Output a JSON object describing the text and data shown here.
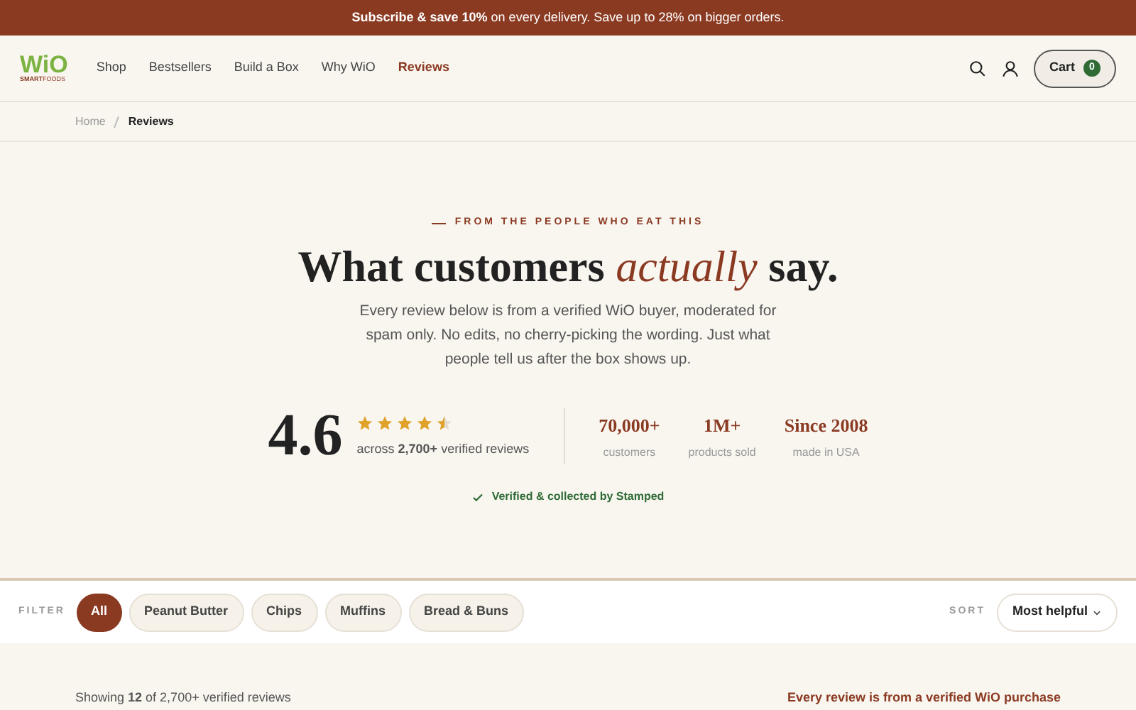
{
  "promo_banner": {
    "text": "**Subscribe & save 10%** on every delivery. Save up to 28% on bigger orders."
  },
  "header": {
    "logo": {
      "wordmark": "WiO",
      "tagline_bold": "SMART",
      "tagline": "FOODS"
    },
    "nav": [
      {
        "label": "Shop",
        "selected": false
      },
      {
        "label": "Bestsellers",
        "selected": false
      },
      {
        "label": "Build a Box",
        "selected": false
      },
      {
        "label": "Why WiO",
        "selected": false
      },
      {
        "label": "Reviews",
        "selected": true
      }
    ],
    "cart": {
      "label": "Cart",
      "count": "0"
    }
  },
  "breadcrumb": [
    {
      "label": "Home",
      "current": false
    },
    {
      "label": "Reviews",
      "current": true
    }
  ],
  "hero": {
    "eyebrow": "FROM THE PEOPLE WHO EAT THIS",
    "title_start": "What customers",
    "title_emphasis": "actually",
    "title_end": "say.",
    "intro": "Every review below is from a verified WiO buyer, moderated for spam only. No edits, no cherry-picking the wording. Just what people tell us after the box shows up.",
    "rating": {
      "score": "4.6",
      "stars": 4.5,
      "summary": "across **2,700+** verified reviews"
    },
    "stats": [
      {
        "value": "70,000+",
        "label": "customers"
      },
      {
        "value": "1M+",
        "label": "products sold"
      },
      {
        "value": "Since 2008",
        "label": "made in USA"
      }
    ],
    "verified_note": "Verified & collected by Stamped"
  },
  "filter_bar": {
    "label": "FILTER",
    "filters": [
      {
        "label": "All",
        "selected": true
      },
      {
        "label": "Peanut Butter",
        "selected": false
      },
      {
        "label": "Chips",
        "selected": false
      },
      {
        "label": "Muffins",
        "selected": false
      },
      {
        "label": "Bread & Buns",
        "selected": false
      }
    ],
    "sort_label": "SORT",
    "sort_value": "Most helpful"
  },
  "results": {
    "count_text": "Showing **12** of 2,700+ verified reviews",
    "verified_note": "Every review is from a verified WiO purchase"
  }
}
